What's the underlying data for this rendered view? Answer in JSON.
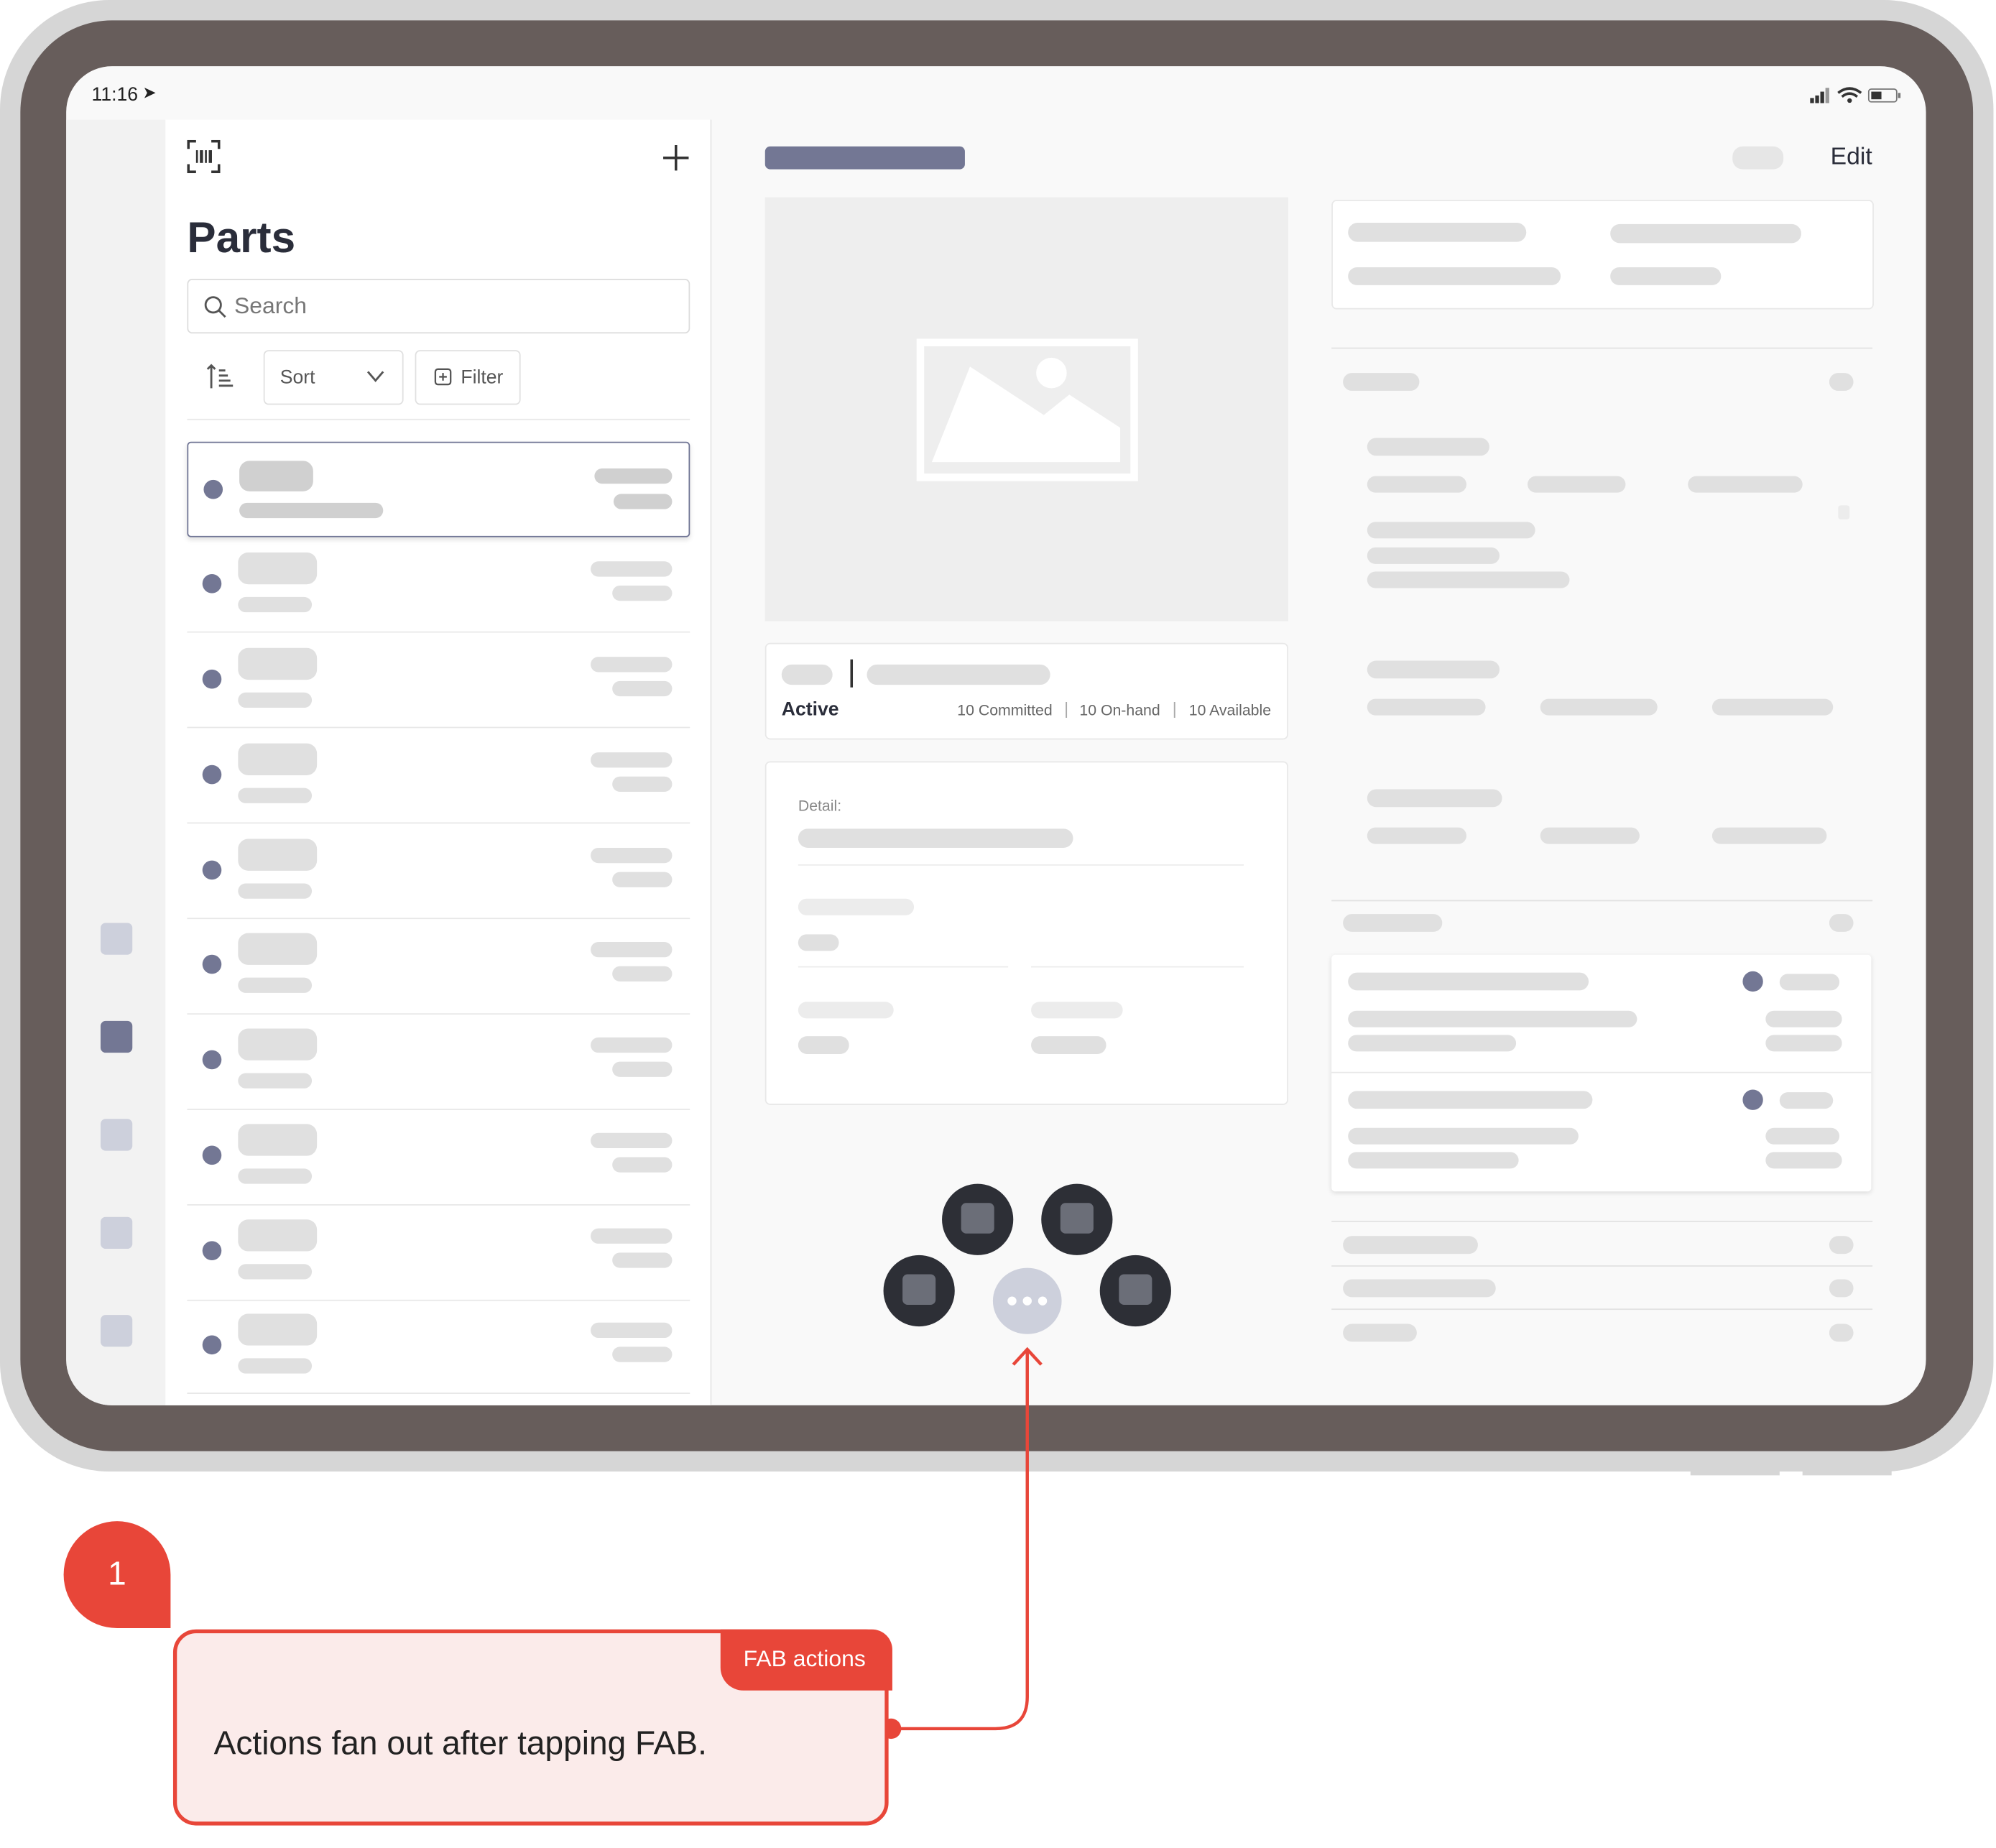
{
  "status_bar": {
    "time": "11:16"
  },
  "list_panel": {
    "title": "Parts",
    "search_placeholder": "Search",
    "sort_label": "Sort",
    "filter_label": "Filter"
  },
  "detail": {
    "edit_label": "Edit",
    "status": "Active",
    "committed": "10 Committed",
    "on_hand": "10 On-hand",
    "available": "10 Available",
    "detail_label": "Detail:"
  },
  "annotation": {
    "number": "1",
    "tag": "FAB actions",
    "text": "Actions fan out after tapping FAB."
  },
  "colors": {
    "accent": "#e84639",
    "callout_bg": "#fbebea",
    "frame": "#675d5b",
    "dot": "#737794"
  }
}
